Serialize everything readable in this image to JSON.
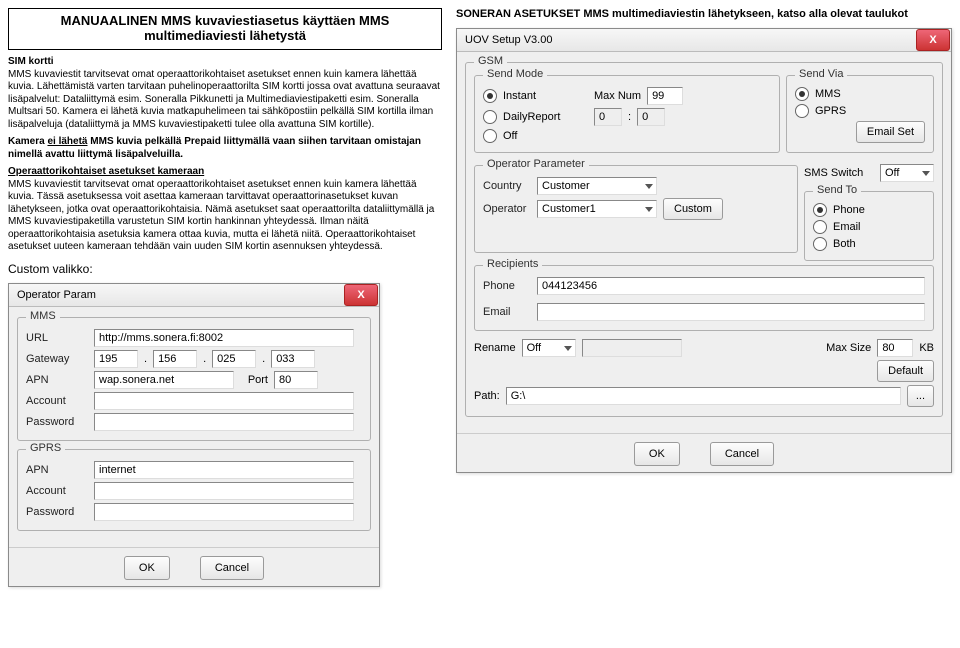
{
  "left": {
    "title1": "MANUAALINEN MMS kuvaviestiasetus käyttäen MMS",
    "title2": "multimediaviesti lähetystä",
    "h_sim": "SIM kortti",
    "p1": "MMS kuvaviestit tarvitsevat omat operaattorikohtaiset asetukset ennen kuin kamera lähettää kuvia. Lähettämistä varten tarvitaan puhelinoperaattorilta SIM kortti jossa ovat avattuna seuraavat lisäpalvelut: Dataliittymä esim. Soneralla Pikkunetti ja Multimediaviestipaketti esim. Soneralla Multsari 50. Kamera ei lähetä kuvia matkapuhelimeen tai sähköpostiin pelkällä SIM kortilla ilman lisäpalveluja (dataliittymä ja MMS kuvaviestipaketti tulee olla avattuna SIM kortille).",
    "p2a": "Kamera ",
    "p2b": "ei lähetä",
    "p2c": " MMS kuvia pelkällä Prepaid liittymällä vaan siihen tarvitaan omistajan nimellä avattu liittymä lisäpalveluilla.",
    "h_op": "Operaattorikohtaiset asetukset kameraan",
    "p3": "MMS kuvaviestit tarvitsevat omat operaattorikohtaiset asetukset ennen kuin kamera lähettää kuvia. Tässä asetuksessa voit asettaa kameraan tarvittavat operaattorinasetukset kuvan lähetykseen, jotka ovat operaattorikohtaisia. Nämä asetukset saat operaattorilta dataliittymällä ja MMS kuvaviestipaketilla varustetun SIM kortin hankinnan yhteydessä. Ilman näitä operaattorikohtaisia asetuksia kamera ottaa kuvia, mutta ei lähetä niitä. Operaattorikohtaiset asetukset uuteen kameraan tehdään vain uuden SIM kortin asennuksen yhteydessä.",
    "custom_menu": "Custom valikko:"
  },
  "right_heading": "SONERAN ASETUKSET MMS multimediaviestin lähetykseen, katso alla olevat taulukot",
  "dlg1": {
    "title": "Operator Param",
    "x": "X",
    "mms": {
      "group": "MMS",
      "url_lbl": "URL",
      "url": "http://mms.sonera.fi:8002",
      "gateway_lbl": "Gateway",
      "gw": [
        "195",
        "156",
        "025",
        "033"
      ],
      "dot": ".",
      "apn_lbl": "APN",
      "apn": "wap.sonera.net",
      "port_lbl": "Port",
      "port": "80",
      "account_lbl": "Account",
      "account": "",
      "password_lbl": "Password",
      "password": ""
    },
    "gprs": {
      "group": "GPRS",
      "apn_lbl": "APN",
      "apn": "internet",
      "account_lbl": "Account",
      "account": "",
      "password_lbl": "Password",
      "password": ""
    },
    "ok": "OK",
    "cancel": "Cancel"
  },
  "dlg2": {
    "title": "UOV Setup V3.00",
    "x": "X",
    "gsm": {
      "group": "GSM",
      "sendmode": {
        "group": "Send Mode",
        "instant": "Instant",
        "daily": "DailyReport",
        "off": "Off",
        "maxnum_lbl": "Max Num",
        "maxnum": "99",
        "daily_val": "0",
        "daily_colon": ":",
        "daily_val2": "0"
      },
      "sendvia": {
        "group": "Send Via",
        "mms": "MMS",
        "gprs": "GPRS",
        "emailset_btn": "Email Set"
      },
      "op": {
        "group": "Operator Parameter",
        "country_lbl": "Country",
        "country": "Customer",
        "operator_lbl": "Operator",
        "operator": "Customer1",
        "custom_btn": "Custom"
      },
      "smsswitch_lbl": "SMS Switch",
      "smsswitch": "Off",
      "sendto": {
        "group": "Send To",
        "phone": "Phone",
        "email": "Email",
        "both": "Both"
      },
      "rcpt": {
        "group": "Recipients",
        "phone_lbl": "Phone",
        "phone": "044123456",
        "email_lbl": "Email",
        "email": ""
      },
      "rename_lbl": "Rename",
      "rename": "Off",
      "rename_val": "",
      "maxsize_lbl": "Max Size",
      "maxsize": "80",
      "kb": "KB",
      "default_btn": "Default",
      "path_lbl": "Path:",
      "path": "G:\\",
      "path_btn": "..."
    },
    "ok": "OK",
    "cancel": "Cancel"
  }
}
